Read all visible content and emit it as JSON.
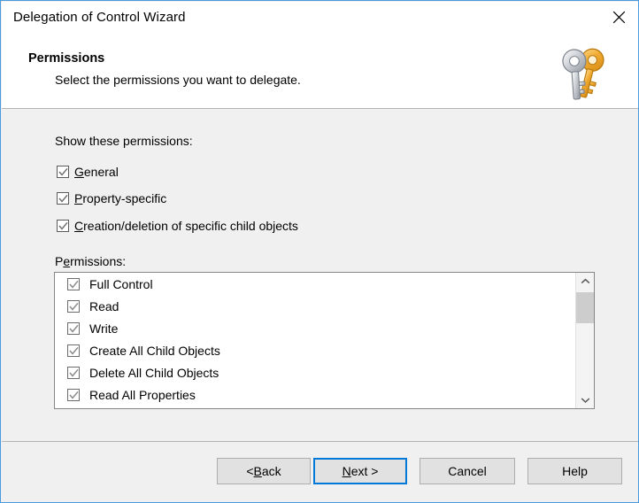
{
  "window": {
    "title": "Delegation of Control Wizard",
    "close_icon": "close-icon",
    "accent_color": "#4a9ae0"
  },
  "header": {
    "title": "Permissions",
    "subtitle": "Select the permissions you want to delegate.",
    "icon": "keys-icon"
  },
  "main": {
    "show_permissions_label": "Show these permissions:",
    "filters": [
      {
        "label_pre": "",
        "accel": "G",
        "label_post": "eneral",
        "checked": true
      },
      {
        "label_pre": "",
        "accel": "P",
        "label_post": "roperty-specific",
        "checked": true
      },
      {
        "label_pre": "",
        "accel": "C",
        "label_post": "reation/deletion of specific child objects",
        "checked": true
      }
    ],
    "permissions_label_pre": "P",
    "permissions_label_accel": "e",
    "permissions_label_post": "rmissions:",
    "permissions": [
      {
        "label": "Full Control",
        "checked": true
      },
      {
        "label": "Read",
        "checked": true
      },
      {
        "label": "Write",
        "checked": true
      },
      {
        "label": "Create All Child Objects",
        "checked": true
      },
      {
        "label": "Delete All Child Objects",
        "checked": true
      },
      {
        "label": "Read All Properties",
        "checked": true
      }
    ],
    "scrollbar": {
      "up_icon": "chevron-up-icon",
      "down_icon": "chevron-down-icon"
    }
  },
  "footer": {
    "back": {
      "pre": "< ",
      "accel": "B",
      "post": "ack"
    },
    "next": {
      "pre": "",
      "accel": "N",
      "post": "ext >"
    },
    "cancel": {
      "pre": "",
      "accel": "C",
      "post": "ancel"
    },
    "help": {
      "pre": "",
      "accel": "H",
      "post": "elp"
    },
    "default_button": "next",
    "focus_color": "#0078d7"
  }
}
